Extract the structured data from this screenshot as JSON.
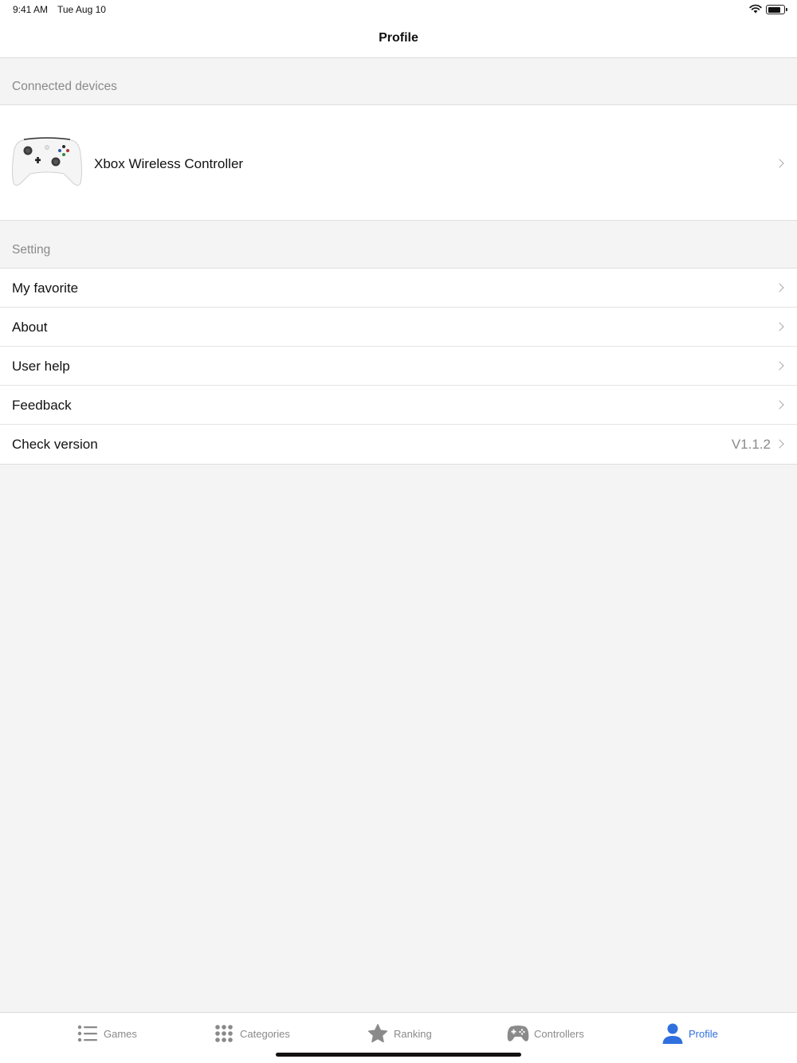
{
  "status_bar": {
    "time": "9:41 AM",
    "date": "Tue Aug 10",
    "battery_level": 0.7
  },
  "nav": {
    "title": "Profile"
  },
  "connected_devices": {
    "header": "Connected devices",
    "device": {
      "name": "Xbox Wireless Controller",
      "icon": "xbox-controller-image"
    }
  },
  "settings": {
    "header": "Setting",
    "items": [
      {
        "label": "My favorite",
        "value": ""
      },
      {
        "label": "About",
        "value": ""
      },
      {
        "label": "User help",
        "value": ""
      },
      {
        "label": "Feedback",
        "value": ""
      },
      {
        "label": "Check version",
        "value": "V1.1.2"
      }
    ]
  },
  "tab_bar": {
    "items": [
      {
        "label": "Games",
        "icon": "list-icon",
        "active": false
      },
      {
        "label": "Categories",
        "icon": "grid-icon",
        "active": false
      },
      {
        "label": "Ranking",
        "icon": "star-icon",
        "active": false
      },
      {
        "label": "Controllers",
        "icon": "gamepad-icon",
        "active": false
      },
      {
        "label": "Profile",
        "icon": "person-icon",
        "active": true
      }
    ]
  },
  "colors": {
    "accent": "#2f6fde",
    "inactive": "#8a8a8a",
    "background": "#f4f4f4"
  }
}
